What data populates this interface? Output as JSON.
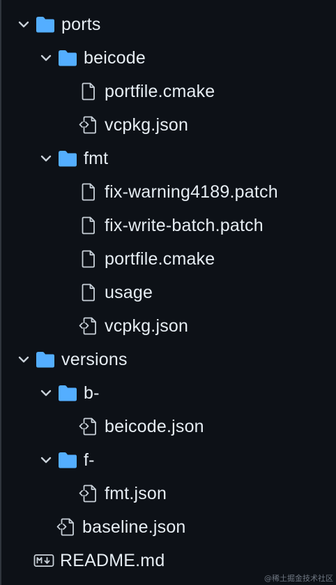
{
  "tree": {
    "items": [
      {
        "label": "ports",
        "type": "folder",
        "depth": 0,
        "expanded": true
      },
      {
        "label": "beicode",
        "type": "folder",
        "depth": 1,
        "expanded": true
      },
      {
        "label": "portfile.cmake",
        "type": "file",
        "depth": 2
      },
      {
        "label": "vcpkg.json",
        "type": "code",
        "depth": 2
      },
      {
        "label": "fmt",
        "type": "folder",
        "depth": 1,
        "expanded": true
      },
      {
        "label": "fix-warning4189.patch",
        "type": "file",
        "depth": 2
      },
      {
        "label": "fix-write-batch.patch",
        "type": "file",
        "depth": 2
      },
      {
        "label": "portfile.cmake",
        "type": "file",
        "depth": 2
      },
      {
        "label": "usage",
        "type": "file",
        "depth": 2
      },
      {
        "label": "vcpkg.json",
        "type": "code",
        "depth": 2
      },
      {
        "label": "versions",
        "type": "folder",
        "depth": 0,
        "expanded": true
      },
      {
        "label": "b-",
        "type": "folder",
        "depth": 1,
        "expanded": true
      },
      {
        "label": "beicode.json",
        "type": "code",
        "depth": 2
      },
      {
        "label": "f-",
        "type": "folder",
        "depth": 1,
        "expanded": true
      },
      {
        "label": "fmt.json",
        "type": "code",
        "depth": 2
      },
      {
        "label": "baseline.json",
        "type": "code",
        "depth": 1
      },
      {
        "label": "README.md",
        "type": "markdown",
        "depth": 0
      }
    ]
  },
  "watermark": "@稀土掘金技术社区",
  "colors": {
    "background": "#0d1117",
    "text": "#e6edf3",
    "folder": "#54aeff",
    "icon": "#c9d1d9"
  },
  "icons": {
    "folder": "folder-icon",
    "file": "file-icon",
    "code": "file-code-icon",
    "markdown": "markdown-icon",
    "chevron": "chevron-down-icon"
  }
}
